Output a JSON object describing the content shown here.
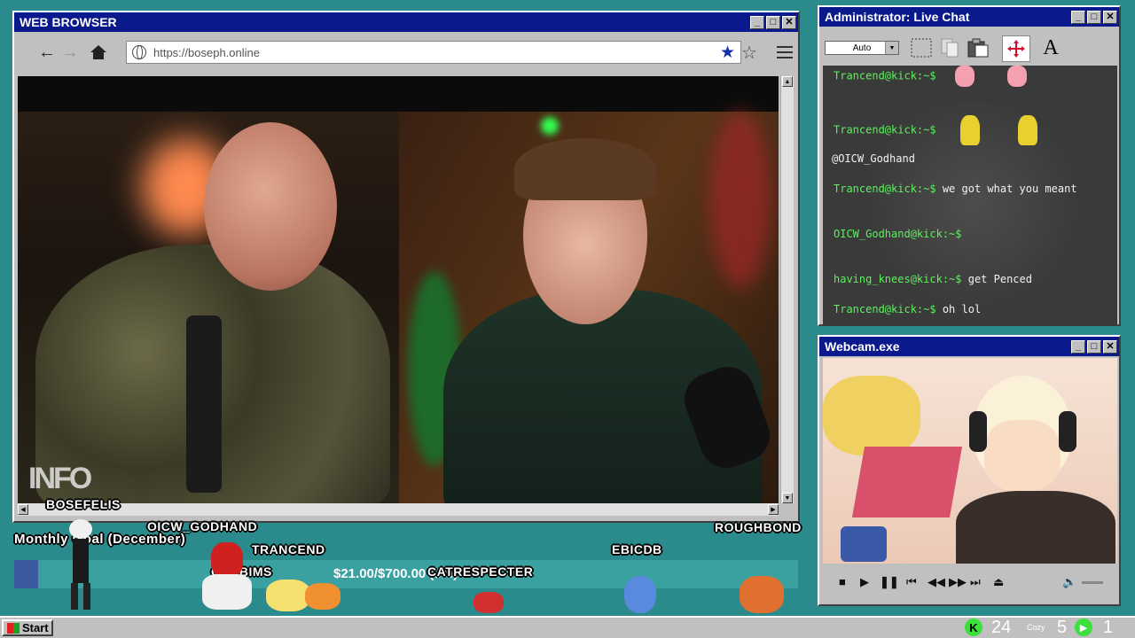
{
  "browser": {
    "title": "WEB BROWSER",
    "url": "https://boseph.online"
  },
  "chat": {
    "title": "Administrator: Live Chat",
    "dropdown_value": "Auto",
    "messages": [
      {
        "user": "Trancend@kick:~$",
        "text": "",
        "emotes": 2
      },
      {
        "user": "Trancend@kick:~$",
        "text": "",
        "emotes": 2
      },
      {
        "user": "",
        "text": "@OICW_Godhand",
        "emotes": 0
      },
      {
        "user": "Trancend@kick:~$",
        "text": "we got what you meant",
        "emotes": 0
      },
      {
        "user": "OICW_Godhand@kick:~$",
        "text": "",
        "emotes": 0
      },
      {
        "user": "having_knees@kick:~$",
        "text": "get Penced",
        "emotes": 0
      },
      {
        "user": "Trancend@kick:~$",
        "text": "oh lol",
        "emotes": 0
      }
    ]
  },
  "webcam": {
    "title": "Webcam.exe"
  },
  "overlay": {
    "goal_label": "Monthly Goal (December)",
    "goal_amount": "$21.00/$700.00 (3%)",
    "goal_progress": 0.03,
    "names": [
      "BOSEFELIS",
      "OICW_GODHAND",
      "TRANCEND",
      "CHUBIMS",
      "CATRESPECTER",
      "EBICDB",
      "ROUGHBOND"
    ]
  },
  "taskbar": {
    "start_label": "Start",
    "count_a": "24",
    "count_b": "5",
    "count_c": "1",
    "tray_text": "Cozy"
  },
  "colors": {
    "desktop": "#2a8a8c",
    "titlebar": "#0a1a8c",
    "chat_user": "#5cf05c"
  }
}
